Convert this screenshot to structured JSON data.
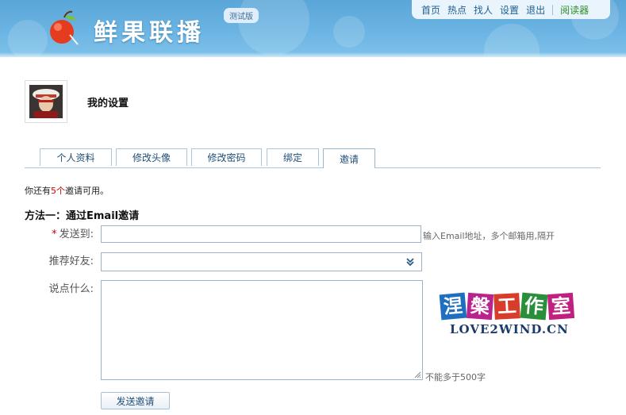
{
  "header": {
    "site_title": "鲜果联播",
    "beta_badge": "测试版",
    "nav": {
      "home": "首页",
      "hot": "热点",
      "find": "找人",
      "settings": "设置",
      "logout": "退出",
      "reader": "阅读器"
    }
  },
  "profile": {
    "page_title": "我的设置"
  },
  "tabs": [
    {
      "label": "个人资料",
      "active": false
    },
    {
      "label": "修改头像",
      "active": false
    },
    {
      "label": "修改密码",
      "active": false
    },
    {
      "label": "绑定",
      "active": false
    },
    {
      "label": "邀请",
      "active": true
    }
  ],
  "invite": {
    "info_prefix": "你还有",
    "count": "5个",
    "info_suffix": "邀请可用。",
    "method_title": "方法一：通过Email邀请",
    "send_to_required": "*",
    "send_to_label": "发送到:",
    "send_to_value": "",
    "send_to_hint": "输入Email地址，多个邮箱用,隔开",
    "friend_label": "推荐好友:",
    "friend_selected": "",
    "message_label": "说点什么:",
    "message_value": "",
    "message_hint": "不能多于500字",
    "submit_label": "发送邀请"
  },
  "watermark": {
    "chars": [
      "涅",
      "槃",
      "工",
      "作",
      "室"
    ],
    "chars_colors": [
      "#1f6fc0",
      "#b8238e",
      "#d83c2a",
      "#2a8f3a",
      "#c02080"
    ],
    "url": "LOVE2WIND.CN"
  },
  "colors": {
    "header_blue": "#6bb4e3",
    "link_blue": "#1f5f92",
    "reader_green": "#2f8f2a",
    "required_red": "#cc0000",
    "tab_border": "#a9c5dc"
  }
}
